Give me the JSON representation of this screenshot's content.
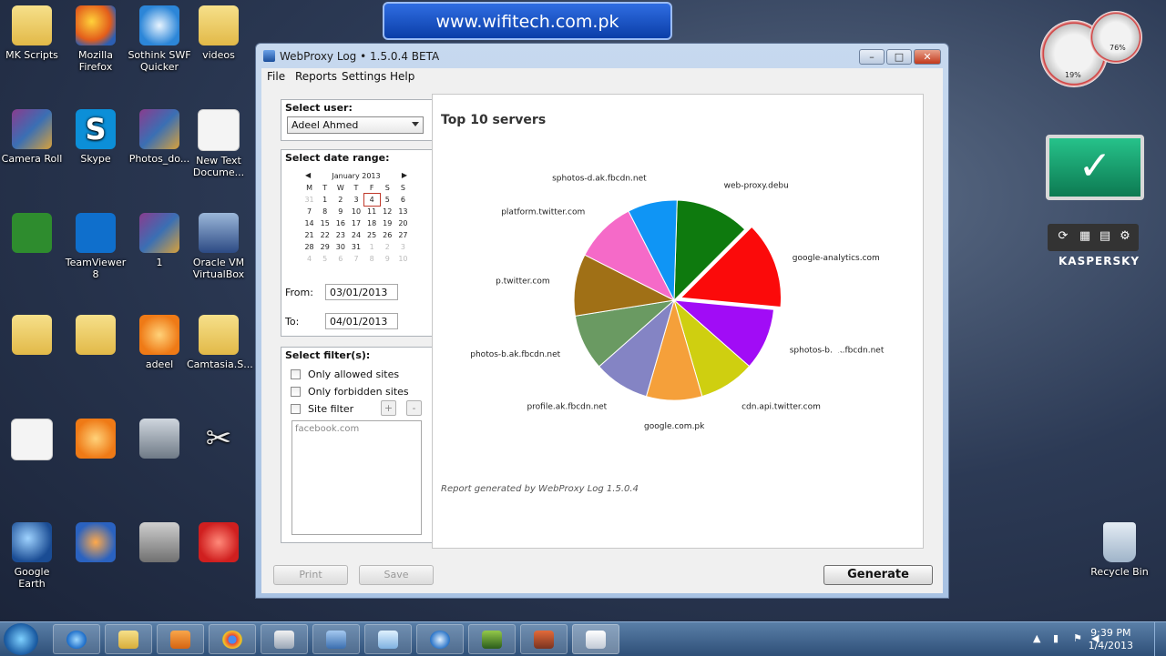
{
  "banner": "www.wifitech.com.pk",
  "desktop_icons": [
    {
      "label": "MK Scripts",
      "icon": "folder-icon"
    },
    {
      "label": "Mozilla\nFirefox",
      "icon": "firefox-icon"
    },
    {
      "label": "Sothink SWF\nQuicker",
      "icon": "sothink-icon"
    },
    {
      "label": "videos",
      "icon": "folder-icon"
    },
    {
      "label": "Camera Roll",
      "icon": "winrar-icon"
    },
    {
      "label": "Skype",
      "icon": "skype-icon"
    },
    {
      "label": "Photos_do...",
      "icon": "winrar-icon"
    },
    {
      "label": "New Text\nDocume...",
      "icon": "text-document-icon"
    },
    {
      "label": "",
      "icon": "utorrent-icon"
    },
    {
      "label": "TeamViewer\n8",
      "icon": "teamviewer-icon"
    },
    {
      "label": "1",
      "icon": "winrar-icon"
    },
    {
      "label": "Oracle VM\nVirtualBox",
      "icon": "virtualbox-icon"
    },
    {
      "label": "",
      "icon": "folder-icon"
    },
    {
      "label": "",
      "icon": "folder-icon"
    },
    {
      "label": "adeel",
      "icon": "image-icon"
    },
    {
      "label": "Camtasia.S...",
      "icon": "folder-icon"
    },
    {
      "label": "",
      "icon": "blank-file-icon"
    },
    {
      "label": "",
      "icon": "orange-app-icon"
    },
    {
      "label": "",
      "icon": "computer-icon"
    },
    {
      "label": "",
      "icon": "scissors-icon"
    },
    {
      "label": "Google Earth",
      "icon": "google-earth-icon"
    },
    {
      "label": "",
      "icon": "media-player-icon"
    },
    {
      "label": "",
      "icon": "counter-strike-icon"
    },
    {
      "label": "",
      "icon": "ccleaner-icon"
    }
  ],
  "recycle_bin": "Recycle Bin",
  "gadgets": {
    "gauge_small": "76%",
    "gauge_large": "19%",
    "kaspersky_label": "KASPERSKY"
  },
  "window": {
    "title": "WebProxy Log • 1.5.0.4 BETA",
    "controls": {
      "minimize": "–",
      "maximize": "□",
      "close": "✕"
    },
    "menu": [
      "File",
      "Reports",
      "Settings",
      "Help"
    ]
  },
  "user_panel": {
    "label": "Select user:",
    "selected_user": "Adeel Ahmed"
  },
  "date_panel": {
    "label": "Select date range:",
    "calendar": {
      "month": "January 2013",
      "prev": "◀",
      "next": "▶",
      "weekdays": [
        "M",
        "T",
        "W",
        "T",
        "F",
        "S",
        "S"
      ],
      "weeks": [
        [
          "31",
          "1",
          "2",
          "3",
          "4",
          "5",
          "6"
        ],
        [
          "7",
          "8",
          "9",
          "10",
          "11",
          "12",
          "13"
        ],
        [
          "14",
          "15",
          "16",
          "17",
          "18",
          "19",
          "20"
        ],
        [
          "21",
          "22",
          "23",
          "24",
          "25",
          "26",
          "27"
        ],
        [
          "28",
          "29",
          "30",
          "31",
          "1",
          "2",
          "3"
        ],
        [
          "4",
          "5",
          "6",
          "7",
          "8",
          "9",
          "10"
        ]
      ],
      "today": "4"
    },
    "from_label": "From:",
    "from_value": "03/01/2013",
    "to_label": "To:",
    "to_value": "04/01/2013"
  },
  "filter_panel": {
    "label": "Select filter(s):",
    "only_allowed": "Only allowed sites",
    "only_forbidden": "Only forbidden sites",
    "site_filter": "Site filter",
    "add": "+",
    "remove": "-",
    "filter_text": "facebook.com"
  },
  "report": {
    "title": "Top 10 servers",
    "footer": "Report generated by WebProxy Log 1.5.0.4"
  },
  "chart_data": {
    "type": "pie",
    "title": "Top 10 servers",
    "slices": [
      {
        "label": "web-proxy.debu",
        "value": 12,
        "color": "#0e7a0e"
      },
      {
        "label": "google-analytics.com",
        "value": 14,
        "color": "#fb0a0a"
      },
      {
        "label": "sphotos-b.ak.fbcdn.net",
        "value": 10,
        "color": "#a10cf6"
      },
      {
        "label": "cdn.api.twitter.com",
        "value": 9,
        "color": "#cfcf10"
      },
      {
        "label": "google.com.pk",
        "value": 9,
        "color": "#f5a03a"
      },
      {
        "label": "profile.ak.fbcdn.net",
        "value": 9,
        "color": "#8484c4"
      },
      {
        "label": "photos-b.ak.fbcdn.net",
        "value": 9,
        "color": "#6a9a62"
      },
      {
        "label": "p.twitter.com",
        "value": 10,
        "color": "#a07016"
      },
      {
        "label": "platform.twitter.com",
        "value": 10,
        "color": "#f56ac8"
      },
      {
        "label": "sphotos-d.ak.fbcdn.net",
        "value": 8,
        "color": "#0f95f5"
      }
    ]
  },
  "buttons": {
    "print": "Print",
    "save": "Save",
    "generate": "Generate"
  },
  "taskbar": {
    "time": "9:39 PM",
    "date": "1/4/2013"
  }
}
